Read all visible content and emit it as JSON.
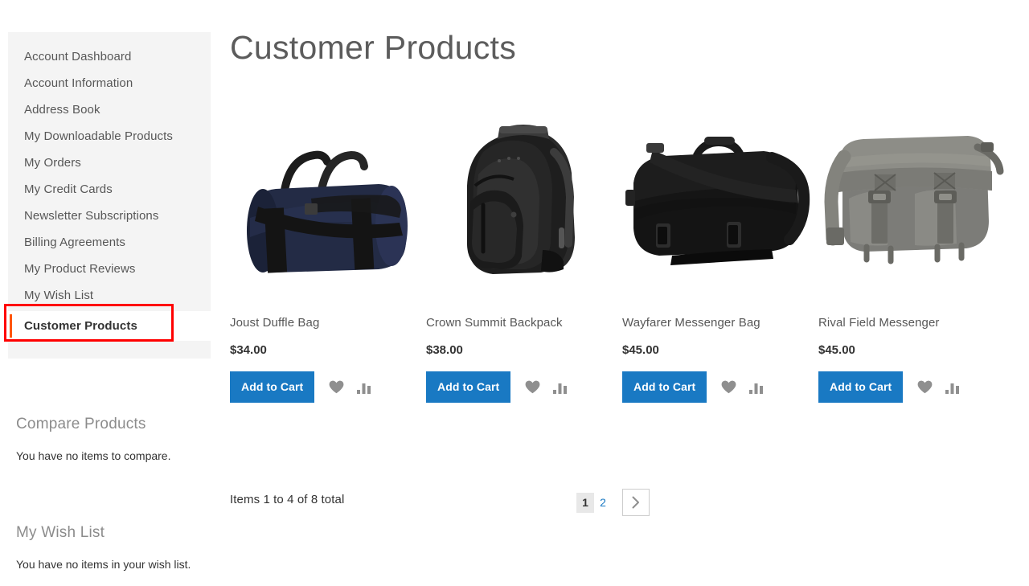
{
  "page": {
    "title": "Customer Products"
  },
  "sidebar": {
    "nav_items": [
      {
        "label": "Account Dashboard",
        "current": false
      },
      {
        "label": "Account Information",
        "current": false
      },
      {
        "label": "Address Book",
        "current": false
      },
      {
        "label": "My Downloadable Products",
        "current": false
      },
      {
        "label": "My Orders",
        "current": false
      },
      {
        "label": "My Credit Cards",
        "current": false
      },
      {
        "label": "Newsletter Subscriptions",
        "current": false
      },
      {
        "label": "Billing Agreements",
        "current": false
      },
      {
        "label": "My Product Reviews",
        "current": false
      },
      {
        "label": "My Wish List",
        "current": false
      },
      {
        "label": "Customer Products",
        "current": true
      }
    ],
    "compare_block": {
      "title": "Compare Products",
      "empty_text": "You have no items to compare."
    },
    "wishlist_block": {
      "title": "My Wish List",
      "empty_text": "You have no items in your wish list."
    }
  },
  "products": [
    {
      "name": "Joust Duffle Bag",
      "price": "$34.00",
      "add_to_cart_label": "Add to Cart",
      "image": "joust-duffle-bag-photo",
      "wishlist_icon": "heart-icon",
      "compare_icon": "compare-bars-icon"
    },
    {
      "name": "Crown Summit Backpack",
      "price": "$38.00",
      "add_to_cart_label": "Add to Cart",
      "image": "crown-summit-backpack-photo",
      "wishlist_icon": "heart-icon",
      "compare_icon": "compare-bars-icon"
    },
    {
      "name": "Wayfarer Messenger Bag",
      "price": "$45.00",
      "add_to_cart_label": "Add to Cart",
      "image": "wayfarer-messenger-bag-photo",
      "wishlist_icon": "heart-icon",
      "compare_icon": "compare-bars-icon"
    },
    {
      "name": "Rival Field Messenger",
      "price": "$45.00",
      "add_to_cart_label": "Add to Cart",
      "image": "rival-field-messenger-photo",
      "wishlist_icon": "heart-icon",
      "compare_icon": "compare-bars-icon"
    }
  ],
  "toolbar": {
    "amount_text": "Items 1 to 4 of 8 total",
    "pages": [
      {
        "label": "1",
        "active": true
      },
      {
        "label": "2",
        "active": false
      }
    ],
    "next_icon": "chevron-right-icon"
  },
  "colors": {
    "accent_orange": "#ff5501",
    "button_blue": "#1979c3",
    "link_blue": "#1979c3",
    "annotation_red": "#ff0000",
    "sidebar_bg": "#f4f4f4"
  }
}
